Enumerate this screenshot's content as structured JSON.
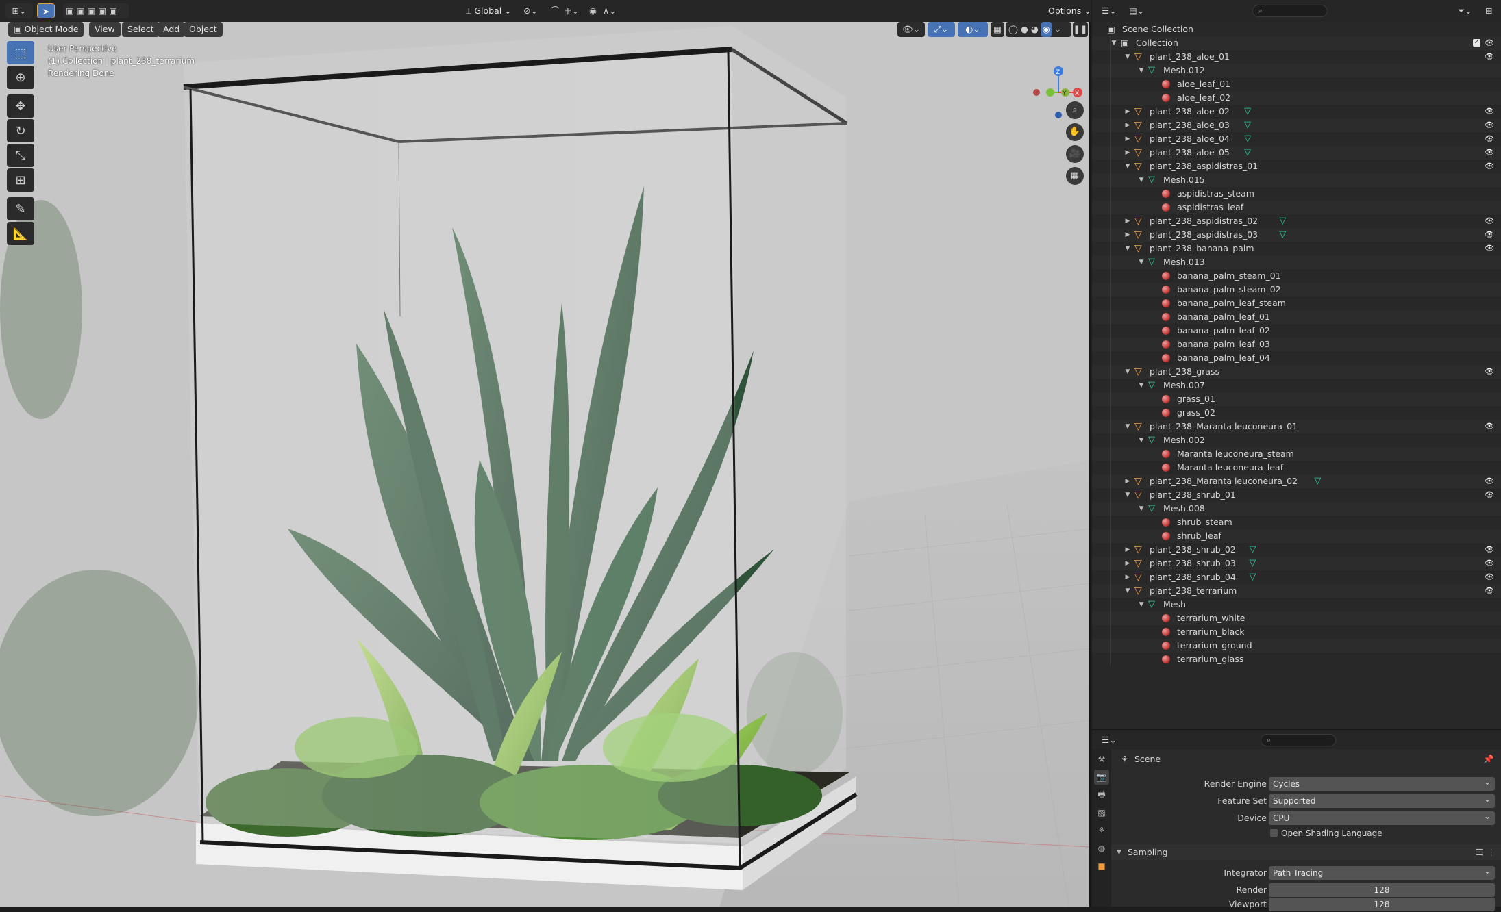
{
  "viewport": {
    "header": {
      "mode": "Object Mode",
      "menus": [
        "View",
        "Select",
        "Add",
        "Object"
      ],
      "transform_orientation": "Global",
      "options": "Options"
    },
    "overlay_text": {
      "line1": "User Perspective",
      "line2": "(1) Collection | plant_238_terrarium",
      "line3": "Rendering Done"
    },
    "gizmo": {
      "z": "Z",
      "y": "Y",
      "x": "X"
    },
    "tools": [
      "select-box",
      "cursor",
      "move",
      "rotate",
      "scale",
      "transform",
      "annotate",
      "measure"
    ]
  },
  "outliner": {
    "search_placeholder": "",
    "rows": [
      {
        "depth": 0,
        "type": "scene",
        "label": "Scene Collection",
        "expand": ""
      },
      {
        "depth": 1,
        "type": "collection",
        "label": "Collection",
        "expand": "▼",
        "check": true
      },
      {
        "depth": 2,
        "type": "object",
        "label": "plant_238_aloe_01",
        "expand": "▼",
        "eye": true
      },
      {
        "depth": 3,
        "type": "mesh",
        "label": "Mesh.012",
        "expand": "▼"
      },
      {
        "depth": 4,
        "type": "material",
        "label": "aloe_leaf_01"
      },
      {
        "depth": 4,
        "type": "material",
        "label": "aloe_leaf_02"
      },
      {
        "depth": 2,
        "type": "object",
        "label": "plant_238_aloe_02",
        "expand": "▶",
        "mesh_child": true,
        "eye": true
      },
      {
        "depth": 2,
        "type": "object",
        "label": "plant_238_aloe_03",
        "expand": "▶",
        "mesh_child": true,
        "eye": true
      },
      {
        "depth": 2,
        "type": "object",
        "label": "plant_238_aloe_04",
        "expand": "▶",
        "mesh_child": true,
        "eye": true
      },
      {
        "depth": 2,
        "type": "object",
        "label": "plant_238_aloe_05",
        "expand": "▶",
        "mesh_child": true,
        "eye": true
      },
      {
        "depth": 2,
        "type": "object",
        "label": "plant_238_aspidistras_01",
        "expand": "▼",
        "eye": true
      },
      {
        "depth": 3,
        "type": "mesh",
        "label": "Mesh.015",
        "expand": "▼"
      },
      {
        "depth": 4,
        "type": "material",
        "label": "aspidistras_steam"
      },
      {
        "depth": 4,
        "type": "material",
        "label": "aspidistras_leaf"
      },
      {
        "depth": 2,
        "type": "object",
        "label": "plant_238_aspidistras_02",
        "expand": "▶",
        "mesh_child": true,
        "eye": true
      },
      {
        "depth": 2,
        "type": "object",
        "label": "plant_238_aspidistras_03",
        "expand": "▶",
        "mesh_child": true,
        "eye": true
      },
      {
        "depth": 2,
        "type": "object",
        "label": "plant_238_banana_palm",
        "expand": "▼",
        "eye": true
      },
      {
        "depth": 3,
        "type": "mesh",
        "label": "Mesh.013",
        "expand": "▼"
      },
      {
        "depth": 4,
        "type": "material",
        "label": "banana_palm_steam_01"
      },
      {
        "depth": 4,
        "type": "material",
        "label": "banana_palm_steam_02"
      },
      {
        "depth": 4,
        "type": "material",
        "label": "banana_palm_leaf_steam"
      },
      {
        "depth": 4,
        "type": "material",
        "label": "banana_palm_leaf_01"
      },
      {
        "depth": 4,
        "type": "material",
        "label": "banana_palm_leaf_02"
      },
      {
        "depth": 4,
        "type": "material",
        "label": "banana_palm_leaf_03"
      },
      {
        "depth": 4,
        "type": "material",
        "label": "banana_palm_leaf_04"
      },
      {
        "depth": 2,
        "type": "object",
        "label": "plant_238_grass",
        "expand": "▼",
        "eye": true
      },
      {
        "depth": 3,
        "type": "mesh",
        "label": "Mesh.007",
        "expand": "▼"
      },
      {
        "depth": 4,
        "type": "material",
        "label": "grass_01"
      },
      {
        "depth": 4,
        "type": "material",
        "label": "grass_02"
      },
      {
        "depth": 2,
        "type": "object",
        "label": "plant_238_Maranta leuconeura_01",
        "expand": "▼",
        "eye": true
      },
      {
        "depth": 3,
        "type": "mesh",
        "label": "Mesh.002",
        "expand": "▼"
      },
      {
        "depth": 4,
        "type": "material",
        "label": "Maranta leuconeura_steam"
      },
      {
        "depth": 4,
        "type": "material",
        "label": "Maranta leuconeura_leaf"
      },
      {
        "depth": 2,
        "type": "object",
        "label": "plant_238_Maranta leuconeura_02",
        "expand": "▶",
        "mesh_child": true,
        "eye": true
      },
      {
        "depth": 2,
        "type": "object",
        "label": "plant_238_shrub_01",
        "expand": "▼",
        "eye": true
      },
      {
        "depth": 3,
        "type": "mesh",
        "label": "Mesh.008",
        "expand": "▼"
      },
      {
        "depth": 4,
        "type": "material",
        "label": "shrub_steam"
      },
      {
        "depth": 4,
        "type": "material",
        "label": "shrub_leaf"
      },
      {
        "depth": 2,
        "type": "object",
        "label": "plant_238_shrub_02",
        "expand": "▶",
        "mesh_child": true,
        "eye": true
      },
      {
        "depth": 2,
        "type": "object",
        "label": "plant_238_shrub_03",
        "expand": "▶",
        "mesh_child": true,
        "eye": true
      },
      {
        "depth": 2,
        "type": "object",
        "label": "plant_238_shrub_04",
        "expand": "▶",
        "mesh_child": true,
        "eye": true
      },
      {
        "depth": 2,
        "type": "object",
        "label": "plant_238_terrarium",
        "expand": "▼",
        "eye": true
      },
      {
        "depth": 3,
        "type": "mesh",
        "label": "Mesh",
        "expand": "▼"
      },
      {
        "depth": 4,
        "type": "material",
        "label": "terrarium_white"
      },
      {
        "depth": 4,
        "type": "material",
        "label": "terrarium_black"
      },
      {
        "depth": 4,
        "type": "material",
        "label": "terrarium_ground"
      },
      {
        "depth": 4,
        "type": "material",
        "label": "terrarium_glass"
      }
    ]
  },
  "properties": {
    "context": "Scene",
    "fields": [
      {
        "label": "Render Engine",
        "value": "Cycles"
      },
      {
        "label": "Feature Set",
        "value": "Supported"
      },
      {
        "label": "Device",
        "value": "CPU"
      }
    ],
    "checkbox_label": "Open Shading Language",
    "section": "Sampling",
    "integrator_label": "Integrator",
    "integrator_value": "Path Tracing",
    "render_label": "Render",
    "render_value": "128",
    "viewport_label": "Viewport",
    "viewport_value": "128"
  },
  "colors": {
    "accent": "#4772b3",
    "object_icon": "#f29a3e",
    "mesh_icon": "#2fd3a9",
    "material_icon": "#c33a3a"
  }
}
